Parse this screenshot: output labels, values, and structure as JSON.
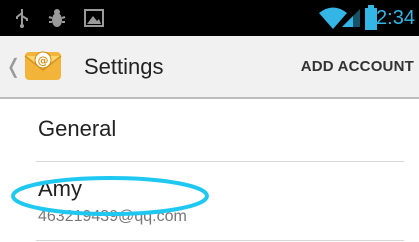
{
  "statusbar": {
    "time": "12:34",
    "icons": [
      "usb-icon",
      "debug-bug-icon",
      "image-notification-icon",
      "wifi-icon",
      "signal-icon",
      "battery-icon"
    ]
  },
  "actionbar": {
    "title": "Settings",
    "action_label": "ADD ACCOUNT",
    "app_icon": "email-app-icon"
  },
  "list": {
    "general_label": "General",
    "account": {
      "name": "Amy",
      "email": "463219439@qq.com"
    }
  },
  "colors": {
    "accent": "#33b5e5",
    "highlight": "#1ec8f0"
  }
}
